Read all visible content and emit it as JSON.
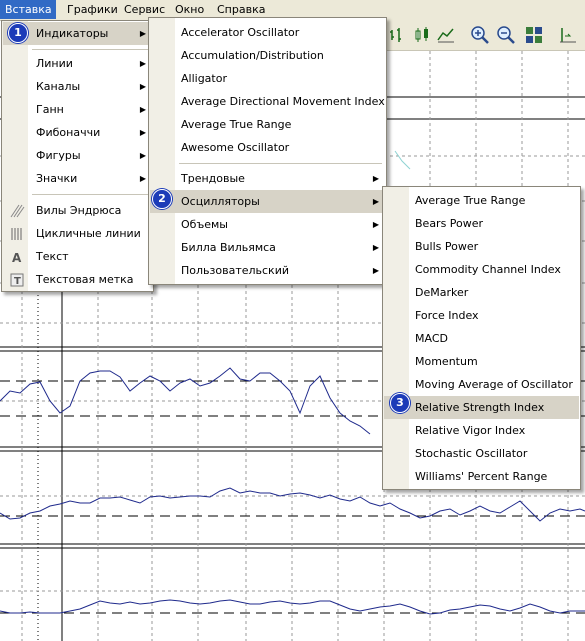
{
  "menubar": {
    "items": [
      {
        "label": "Вставка"
      },
      {
        "label": "Графики"
      },
      {
        "label": "Сервис"
      },
      {
        "label": "Окно"
      },
      {
        "label": "Справка"
      }
    ]
  },
  "insert_menu": {
    "items": [
      {
        "label": "Индикаторы"
      },
      {
        "label": "Линии"
      },
      {
        "label": "Каналы"
      },
      {
        "label": "Ганн"
      },
      {
        "label": "Фибоначчи"
      },
      {
        "label": "Фигуры"
      },
      {
        "label": "Значки"
      },
      {
        "label": "Вилы Эндрюса"
      },
      {
        "label": "Цикличные линии"
      },
      {
        "label": "Текст"
      },
      {
        "label": "Текстовая метка"
      }
    ]
  },
  "indicators_menu": {
    "items": [
      {
        "label": "Accelerator Oscillator"
      },
      {
        "label": "Accumulation/Distribution"
      },
      {
        "label": "Alligator"
      },
      {
        "label": "Average Directional Movement Index"
      },
      {
        "label": "Average True Range"
      },
      {
        "label": "Awesome Oscillator"
      },
      {
        "label": "Трендовые"
      },
      {
        "label": "Осцилляторы"
      },
      {
        "label": "Объемы"
      },
      {
        "label": "Билла Вильямса"
      },
      {
        "label": "Пользовательский"
      }
    ]
  },
  "oscillators_menu": {
    "items": [
      {
        "label": "Average True Range"
      },
      {
        "label": "Bears Power"
      },
      {
        "label": "Bulls Power"
      },
      {
        "label": "Commodity Channel Index"
      },
      {
        "label": "DeMarker"
      },
      {
        "label": "Force Index"
      },
      {
        "label": "MACD"
      },
      {
        "label": "Momentum"
      },
      {
        "label": "Moving Average of Oscillator"
      },
      {
        "label": "Relative Strength Index"
      },
      {
        "label": "Relative Vigor Index"
      },
      {
        "label": "Stochastic Oscillator"
      },
      {
        "label": "Williams' Percent Range"
      }
    ]
  },
  "callouts": [
    "1",
    "2",
    "3"
  ],
  "colors": {
    "menubar_bg": "#ece9d8",
    "highlight": "#316ac5",
    "badge": "#1c3bb8",
    "indicator_line": "#1f2a8c"
  }
}
